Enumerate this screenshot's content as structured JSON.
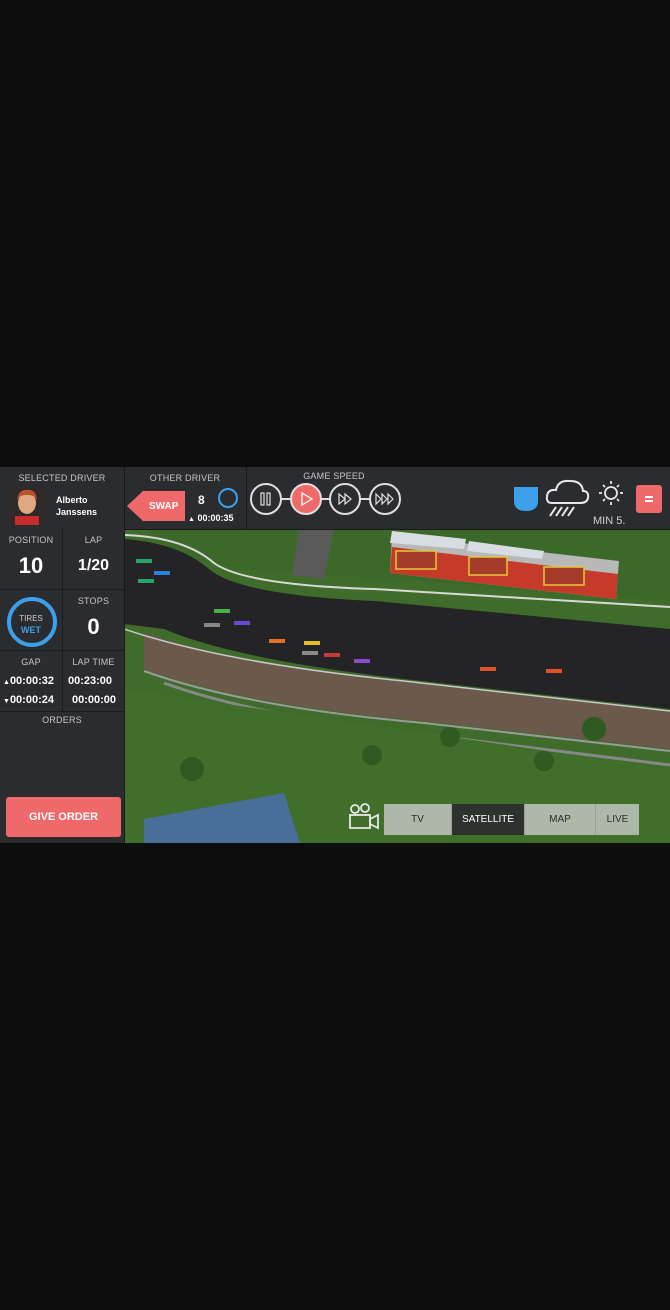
{
  "selected_driver": {
    "label": "SELECTED DRIVER",
    "first_name": "Alberto",
    "last_name": "Janssens"
  },
  "other_driver": {
    "label": "OTHER DRIVER",
    "swap_label": "SWAP",
    "position": "8",
    "gap": "00:00:35",
    "gap_direction": "up"
  },
  "game_speed": {
    "label": "GAME SPEED",
    "buttons": [
      "pause-icon",
      "play-icon",
      "fast-forward-icon",
      "fastest-forward-icon"
    ],
    "active_index": 1
  },
  "weather": {
    "icons": [
      "shield-icon",
      "rain-cloud-icon",
      "sun-icon"
    ],
    "time_label": "MIN 5."
  },
  "stats": {
    "position_label": "POSITION",
    "position_value": "10",
    "lap_label": "LAP",
    "lap_value": "1/20",
    "tires_label": "TIRES",
    "tires_value": "WET",
    "stops_label": "STOPS",
    "stops_value": "0",
    "gap_label": "GAP",
    "gap_ahead": "00:00:32",
    "gap_behind": "00:00:24",
    "lap_time_label": "LAP TIME",
    "lap_time_current": "00:23:00",
    "lap_time_last": "00:00:00"
  },
  "orders": {
    "label": "ORDERS",
    "button_label": "GIVE ORDER"
  },
  "camera_tabs": [
    "TV",
    "SATELLITE",
    "MAP",
    "LIVE TIMES"
  ],
  "camera_active": "SATELLITE",
  "colors": {
    "accent": "#f0696a",
    "tire_blue": "#3ca1ea",
    "panel": "#2b2c30",
    "grass": "#3d6a2a",
    "track": "#1f1f21"
  }
}
